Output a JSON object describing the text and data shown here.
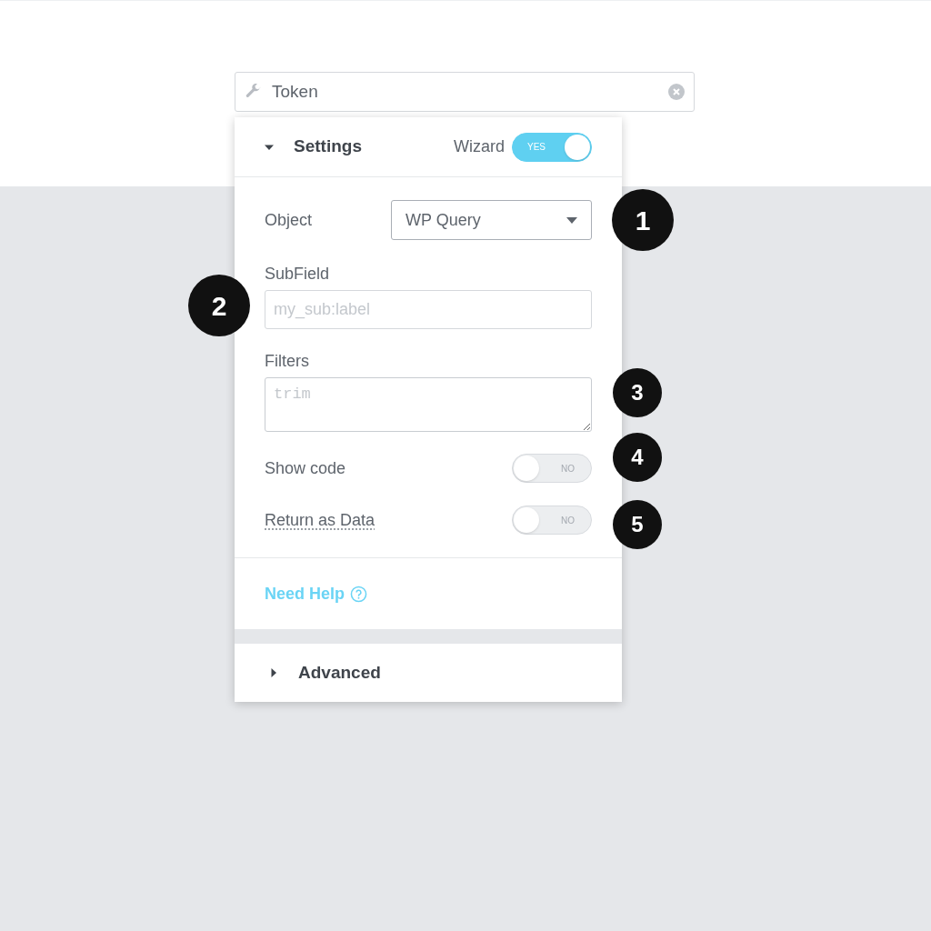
{
  "search_field": {
    "value": "Token"
  },
  "panel": {
    "header": {
      "title": "Settings",
      "expanded": true,
      "toggle_label": "Wizard",
      "toggle": {
        "on": true,
        "text": "YES"
      }
    },
    "fields": [
      {
        "kind": "select",
        "label": "Object",
        "value": "WP Query"
      },
      {
        "kind": "text",
        "label": "SubField",
        "placeholder": "my_sub:label"
      },
      {
        "kind": "textarea",
        "label": "Filters",
        "placeholder": "trim"
      },
      {
        "kind": "toggle",
        "label": "Show code",
        "on": false,
        "text": "NO",
        "underlined": false
      },
      {
        "kind": "toggle",
        "label": "Return as Data",
        "on": false,
        "text": "NO",
        "underlined": true
      }
    ],
    "help_link": "Need Help",
    "sections": [
      {
        "title": "Advanced",
        "expanded": false
      }
    ]
  },
  "callouts": [
    "1",
    "2",
    "3",
    "4",
    "5"
  ]
}
